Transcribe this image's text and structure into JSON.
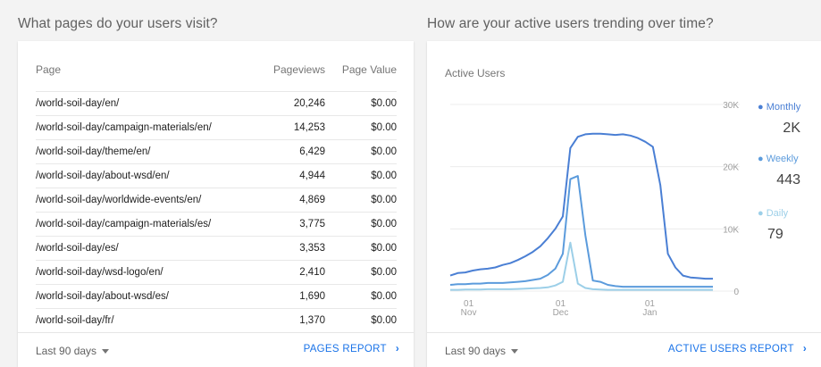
{
  "left": {
    "title": "What pages do your users visit?",
    "headers": {
      "page": "Page",
      "pageviews": "Pageviews",
      "value": "Page Value"
    },
    "rows": [
      {
        "page": "/world-soil-day/en/",
        "pageviews": "20,246",
        "value": "$0.00"
      },
      {
        "page": "/world-soil-day/campaign-materials/en/",
        "pageviews": "14,253",
        "value": "$0.00"
      },
      {
        "page": "/world-soil-day/theme/en/",
        "pageviews": "6,429",
        "value": "$0.00"
      },
      {
        "page": "/world-soil-day/about-wsd/en/",
        "pageviews": "4,944",
        "value": "$0.00"
      },
      {
        "page": "/world-soil-day/worldwide-events/en/",
        "pageviews": "4,869",
        "value": "$0.00"
      },
      {
        "page": "/world-soil-day/campaign-materials/es/",
        "pageviews": "3,775",
        "value": "$0.00"
      },
      {
        "page": "/world-soil-day/es/",
        "pageviews": "3,353",
        "value": "$0.00"
      },
      {
        "page": "/world-soil-day/wsd-logo/en/",
        "pageviews": "2,410",
        "value": "$0.00"
      },
      {
        "page": "/world-soil-day/about-wsd/es/",
        "pageviews": "1,690",
        "value": "$0.00"
      },
      {
        "page": "/world-soil-day/fr/",
        "pageviews": "1,370",
        "value": "$0.00"
      }
    ],
    "footer": {
      "range": "Last 90 days",
      "link": "PAGES REPORT"
    }
  },
  "right": {
    "title": "How are your active users trending over time?",
    "chart_title": "Active Users",
    "footer": {
      "range": "Last 90 days",
      "link": "ACTIVE USERS REPORT"
    },
    "legend": [
      {
        "label": "Monthly",
        "value": "2K",
        "color": "#4a7fd4"
      },
      {
        "label": "Weekly",
        "value": "443",
        "color": "#5b9bdc"
      },
      {
        "label": "Daily",
        "value": "79",
        "color": "#9ccfe8"
      }
    ]
  },
  "chart_data": {
    "type": "line",
    "title": "Active Users",
    "yticks": [
      "30K",
      "20K",
      "10K",
      "0"
    ],
    "ylim": [
      0,
      30000
    ],
    "xticks": [
      {
        "day": "01",
        "month": "Nov",
        "t": 0.07
      },
      {
        "day": "01",
        "month": "Dec",
        "t": 0.42
      },
      {
        "day": "01",
        "month": "Jan",
        "t": 0.76
      }
    ],
    "grid": true,
    "series": [
      {
        "name": "Monthly",
        "color": "#4a7fd4",
        "values": [
          2500,
          2900,
          3000,
          3300,
          3500,
          3600,
          3800,
          4200,
          4500,
          5000,
          5600,
          6300,
          7200,
          8500,
          10000,
          12000,
          23000,
          24800,
          25200,
          25300,
          25300,
          25200,
          25100,
          25200,
          25000,
          24600,
          24000,
          23200,
          17000,
          6000,
          3800,
          2500,
          2200,
          2100,
          2000,
          2000
        ]
      },
      {
        "name": "Weekly",
        "color": "#5b9bdc",
        "values": [
          1000,
          1100,
          1100,
          1200,
          1200,
          1300,
          1300,
          1300,
          1400,
          1500,
          1600,
          1800,
          2000,
          2600,
          3600,
          6000,
          18000,
          18500,
          9000,
          1700,
          1500,
          1000,
          800,
          700,
          700,
          700,
          700,
          700,
          700,
          700,
          700,
          700,
          700,
          700,
          700,
          700
        ]
      },
      {
        "name": "Daily",
        "color": "#9ccfe8",
        "values": [
          200,
          200,
          250,
          250,
          250,
          300,
          300,
          300,
          300,
          350,
          400,
          450,
          500,
          600,
          900,
          1500,
          7800,
          1200,
          500,
          300,
          250,
          200,
          200,
          200,
          200,
          200,
          200,
          200,
          200,
          200,
          200,
          200,
          200,
          200,
          200,
          200
        ]
      }
    ]
  }
}
